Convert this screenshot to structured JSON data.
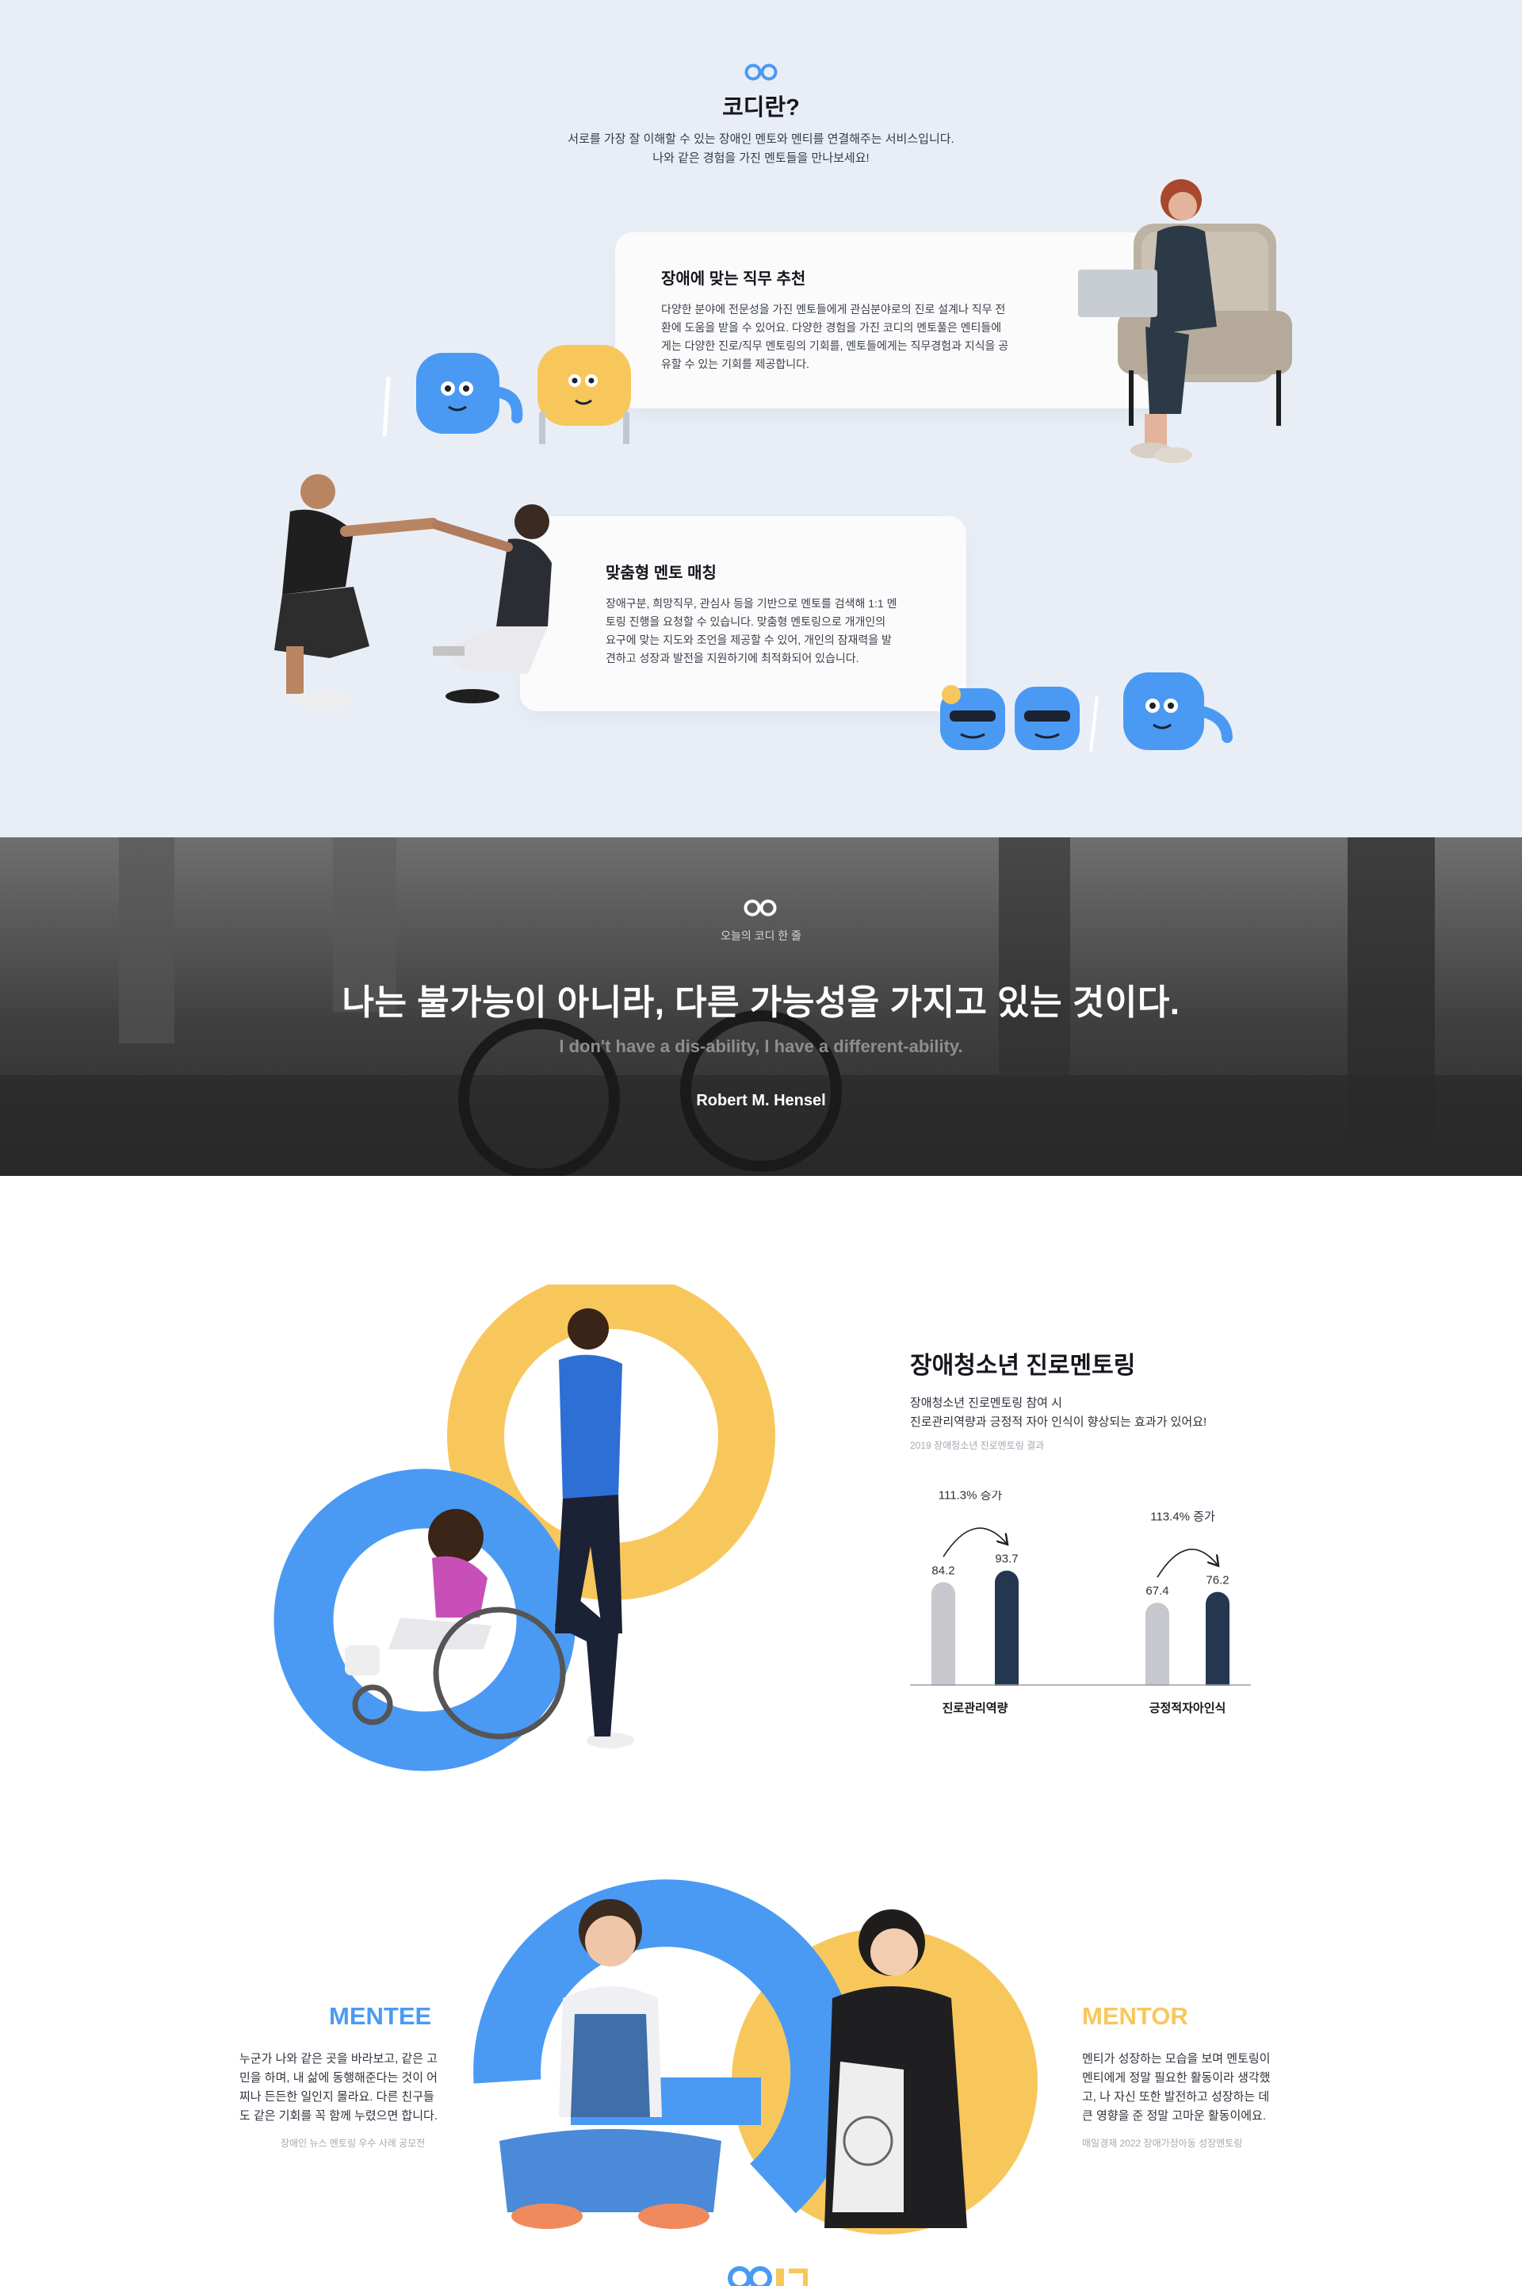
{
  "intro": {
    "title": "코디란?",
    "desc_line1": "서로를 가장 잘 이해할 수 있는 장애인 멘토와 멘티를 연결해주는 서비스입니다.",
    "desc_line2": "나와 같은 경험을 가진 멘토들을 만나보세요!"
  },
  "features": [
    {
      "title": "장애에 맞는 직무 추천",
      "lines": [
        "다양한 분야에 전문성을 가진 멘토들에게 관심분야로의 진로 설계나 직무 전",
        "환에 도움을 받을 수 있어요. 다양한 경험을 가진 코디의 멘토풀은 멘티들에",
        "게는 다양한 진로/직무 멘토링의 기회를, 멘토들에게는 직무경험과 지식을 공",
        "유할 수 있는 기회를 제공합니다."
      ]
    },
    {
      "title": "맞춤형 멘토 매칭",
      "lines": [
        "장애구분, 희망직무, 관심사 등을 기반으로 멘토를 검색해 1:1 멘",
        "토링 진행을 요청할 수 있습니다. 맞춤형 멘토링으로 개개인의",
        "요구에 맞는 지도와 조언을 제공할 수 있어, 개인의 잠재력을 발",
        "견하고 성장과 발전을 지원하기에 최적화되어 있습니다."
      ]
    }
  ],
  "quote": {
    "subtitle": "오늘의 코디 한 줄",
    "main": "나는 불가능이 아니라, 다른 가능성을 가지고 있는 것이다.",
    "english": "I don't have a dis-ability, I have a different-ability.",
    "author": "Robert M. Hensel"
  },
  "stats": {
    "title": "장애청소년 진로멘토링",
    "desc_line1": "장애청소년 진로멘토링 참여 시",
    "desc_line2": "진로관리역량과 긍정적 자아 인식이 향상되는 효과가 있어요!",
    "source": "2019 장애청소년 진로멘토링 결과"
  },
  "chart_data": {
    "type": "bar",
    "categories": [
      "진로관리역량",
      "긍정적자아인식"
    ],
    "series": [
      {
        "values": [
          84.2,
          67.4
        ]
      },
      {
        "values": [
          93.7,
          76.2
        ]
      }
    ],
    "annotations": [
      "111.3% 증가",
      "113.4% 증가"
    ],
    "colors": [
      "#c6c8ce",
      "#243650"
    ]
  },
  "mentee": {
    "title": "MENTEE",
    "lines": [
      "누군가 나와 같은 곳을 바라보고, 같은 고",
      "민을 하며, 내 삶에 동행해준다는 것이 어",
      "찌나 든든한 일인지 몰라요. 다른 친구들",
      "도 같은 기회를 꼭 함께 누렸으면 합니다."
    ],
    "source": "장애인 뉴스 멘토링 우수 사례 공모전"
  },
  "mentor": {
    "title": "MENTOR",
    "lines": [
      "멘티가 성장하는 모습을 보며 멘토링이",
      "멘티에게 정말 필요한 활동이라 생각했",
      "고, 나 자신 또한 발전하고 성장하는 데",
      "큰 영향을 준 정말 고마운 활동이에요."
    ],
    "source": "매일경제 2022 장애가정아동 성장멘토링"
  },
  "colors": {
    "blue": "#4a9af4",
    "yellow": "#f8c75c",
    "navy": "#243650",
    "bg": "#e9eef6"
  }
}
